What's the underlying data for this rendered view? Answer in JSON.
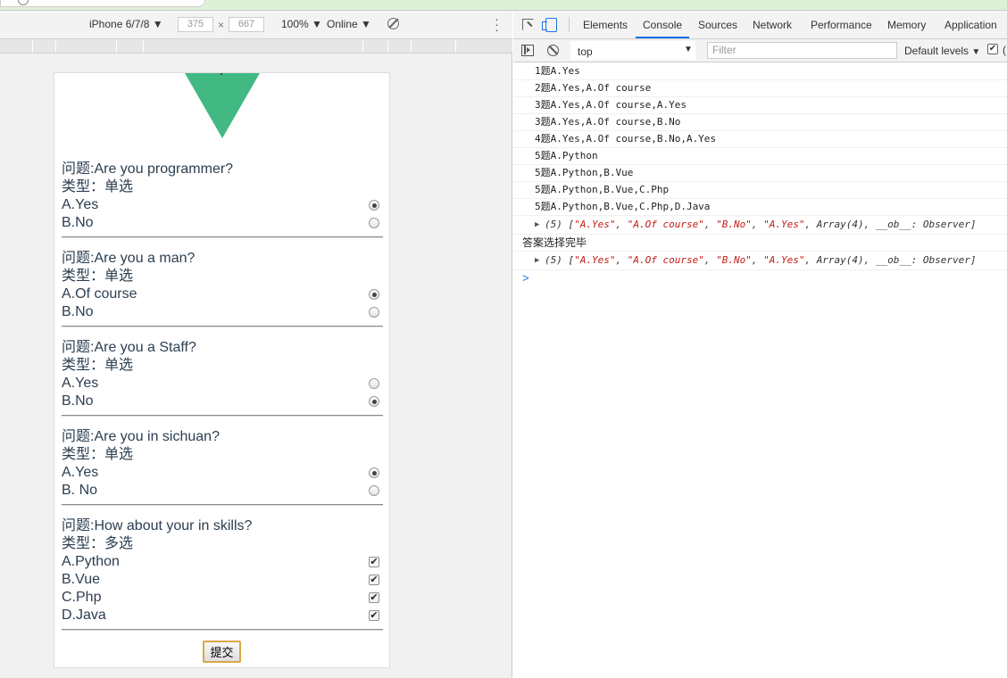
{
  "device_toolbar": {
    "device": "iPhone 6/7/8",
    "width": "375",
    "x": "×",
    "height": "667",
    "zoom": "100%",
    "network": "Online"
  },
  "questions": [
    {
      "title": "问题:Are you programmer?",
      "type": "类型：单选",
      "options": [
        {
          "label": "A.Yes",
          "checked": true
        },
        {
          "label": "B.No",
          "checked": false
        }
      ]
    },
    {
      "title": "问题:Are you a man?",
      "type": "类型：单选",
      "options": [
        {
          "label": "A.Of course",
          "checked": true
        },
        {
          "label": "B.No",
          "checked": false
        }
      ]
    },
    {
      "title": "问题:Are you a Staff?",
      "type": "类型：单选",
      "options": [
        {
          "label": "A.Yes",
          "checked": false
        },
        {
          "label": "B.No",
          "checked": true
        }
      ]
    },
    {
      "title": "问题:Are you in sichuan?",
      "type": "类型：单选",
      "options": [
        {
          "label": "A.Yes",
          "checked": true
        },
        {
          "label": "B. No",
          "checked": false
        }
      ]
    },
    {
      "title": "问题:How about your in skills?",
      "type": "类型：多选",
      "options": [
        {
          "label": "A.Python",
          "checked": true
        },
        {
          "label": "B.Vue",
          "checked": true
        },
        {
          "label": "C.Php",
          "checked": true
        },
        {
          "label": "D.Java",
          "checked": true
        }
      ]
    }
  ],
  "submit_label": "提交",
  "devtools": {
    "tabs": [
      "Elements",
      "Console",
      "Sources",
      "Network",
      "Performance",
      "Memory",
      "Application"
    ],
    "active_tab": "Console",
    "context": "top",
    "filter_placeholder": "Filter",
    "levels": "Default levels"
  },
  "console": {
    "logs": [
      "1题A.Yes",
      "2题A.Yes,A.Of course",
      "3题A.Yes,A.Of course,A.Yes",
      "3题A.Yes,A.Of course,B.No",
      "4题A.Yes,A.Of course,B.No,A.Yes",
      "5题A.Python",
      "5题A.Python,B.Vue",
      "5题A.Python,B.Vue,C.Php",
      "5题A.Python,B.Vue,C.Php,D.Java"
    ],
    "array_prefix": "(5) [",
    "array_strings": [
      "\"A.Yes\"",
      "\"A.Of course\"",
      "\"B.No\"",
      "\"A.Yes\""
    ],
    "array_suffix": "Array(4), __ob__: Observer]",
    "done_message": "答案选择完毕",
    "prompt": ">"
  }
}
